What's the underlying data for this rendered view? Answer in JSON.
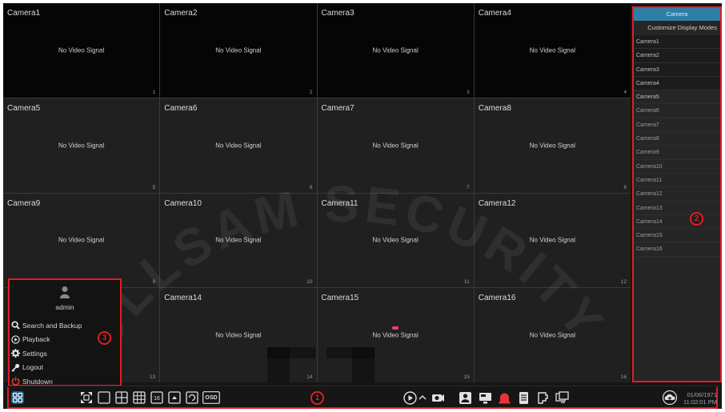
{
  "grid": {
    "cells": [
      {
        "name": "Camera1",
        "signal": "No Video Signal",
        "num": "1"
      },
      {
        "name": "Camera2",
        "signal": "No Video Signal",
        "num": "2"
      },
      {
        "name": "Camera3",
        "signal": "No Video Signal",
        "num": "3"
      },
      {
        "name": "Camera4",
        "signal": "No Video Signal",
        "num": "4"
      },
      {
        "name": "Camera5",
        "signal": "No Video Signal",
        "num": "5"
      },
      {
        "name": "Camera6",
        "signal": "No Video Signal",
        "num": "6"
      },
      {
        "name": "Camera7",
        "signal": "No Video Signal",
        "num": "7"
      },
      {
        "name": "Camera8",
        "signal": "No Video Signal",
        "num": "8"
      },
      {
        "name": "Camera9",
        "signal": "No Video Signal",
        "num": "9"
      },
      {
        "name": "Camera10",
        "signal": "No Video Signal",
        "num": "10"
      },
      {
        "name": "Camera11",
        "signal": "No Video Signal",
        "num": "11"
      },
      {
        "name": "Camera12",
        "signal": "No Video Signal",
        "num": "12"
      },
      {
        "name": "",
        "signal": "",
        "num": "13"
      },
      {
        "name": "Camera14",
        "signal": "No Video Signal",
        "num": "14"
      },
      {
        "name": "Camera15",
        "signal": "No Video Signal",
        "num": "15"
      },
      {
        "name": "Camera16",
        "signal": "No Video Signal",
        "num": "16"
      }
    ]
  },
  "watermark": "OLLSAM SECURITY",
  "sidepanel": {
    "tab_label": "Camera",
    "subtitle": "Customize Display Modes",
    "cameras": [
      "Camera1",
      "Camera2",
      "Camera3",
      "Camera4",
      "Camera5",
      "Camera6",
      "Camera7",
      "Camera8",
      "Camera9",
      "Camera10",
      "Camera11",
      "Camera12",
      "Camera13",
      "Camera14",
      "Camera15",
      "Camera16"
    ]
  },
  "markers": {
    "taskbar": "1",
    "sidepanel": "2",
    "usermenu": "3"
  },
  "user_menu": {
    "username": "admin",
    "items": [
      {
        "label": "Search and Backup",
        "icon": "search-icon"
      },
      {
        "label": "Playback",
        "icon": "play-circle-icon"
      },
      {
        "label": "Settings",
        "icon": "gear-icon"
      },
      {
        "label": "Logout",
        "icon": "key-icon"
      },
      {
        "label": "Shutdown",
        "icon": "power-icon"
      }
    ]
  },
  "taskbar": {
    "osd_label": "OSD",
    "date": "01/06/1971",
    "time": "11:02:01 PM"
  },
  "colors": {
    "highlight": "#e21d24",
    "accent": "#2d7fa5",
    "alarm": "#e8333a"
  }
}
